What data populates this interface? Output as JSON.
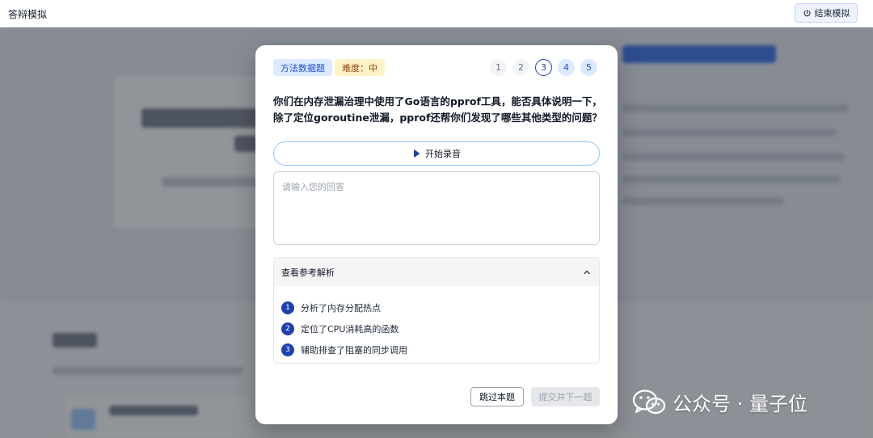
{
  "topbar": {
    "title": "答辩模拟",
    "end_label": "结束模拟"
  },
  "modal": {
    "type_tag": "方法数据题",
    "difficulty_tag": "难度：中",
    "steps": [
      "1",
      "2",
      "3",
      "4",
      "5"
    ],
    "current_step": 3,
    "question": "你们在内存泄漏治理中使用了Go语言的pprof工具，能否具体说明一下，除了定位goroutine泄漏，pprof还帮你们发现了哪些其他类型的问题？",
    "record_label": "开始录音",
    "answer_value": "",
    "answer_placeholder": "请输入您的回答",
    "analysis_title": "查看参考解析",
    "analysis_items": [
      {
        "num": "1",
        "text": "分析了内存分配热点"
      },
      {
        "num": "2",
        "text": "定位了CPU消耗高的函数"
      },
      {
        "num": "3",
        "text": "辅助排查了阻塞的同步调用"
      }
    ],
    "skip_label": "跳过本题",
    "submit_label": "提交并下一题"
  },
  "watermark": {
    "text": "公众号 · 量子位",
    "icon": "wechat-icon"
  },
  "colors": {
    "accent": "#1e40af",
    "tag_blue_bg": "#dbeafe",
    "tag_yellow_bg": "#fef3c7",
    "overlay": "#4b5060"
  }
}
